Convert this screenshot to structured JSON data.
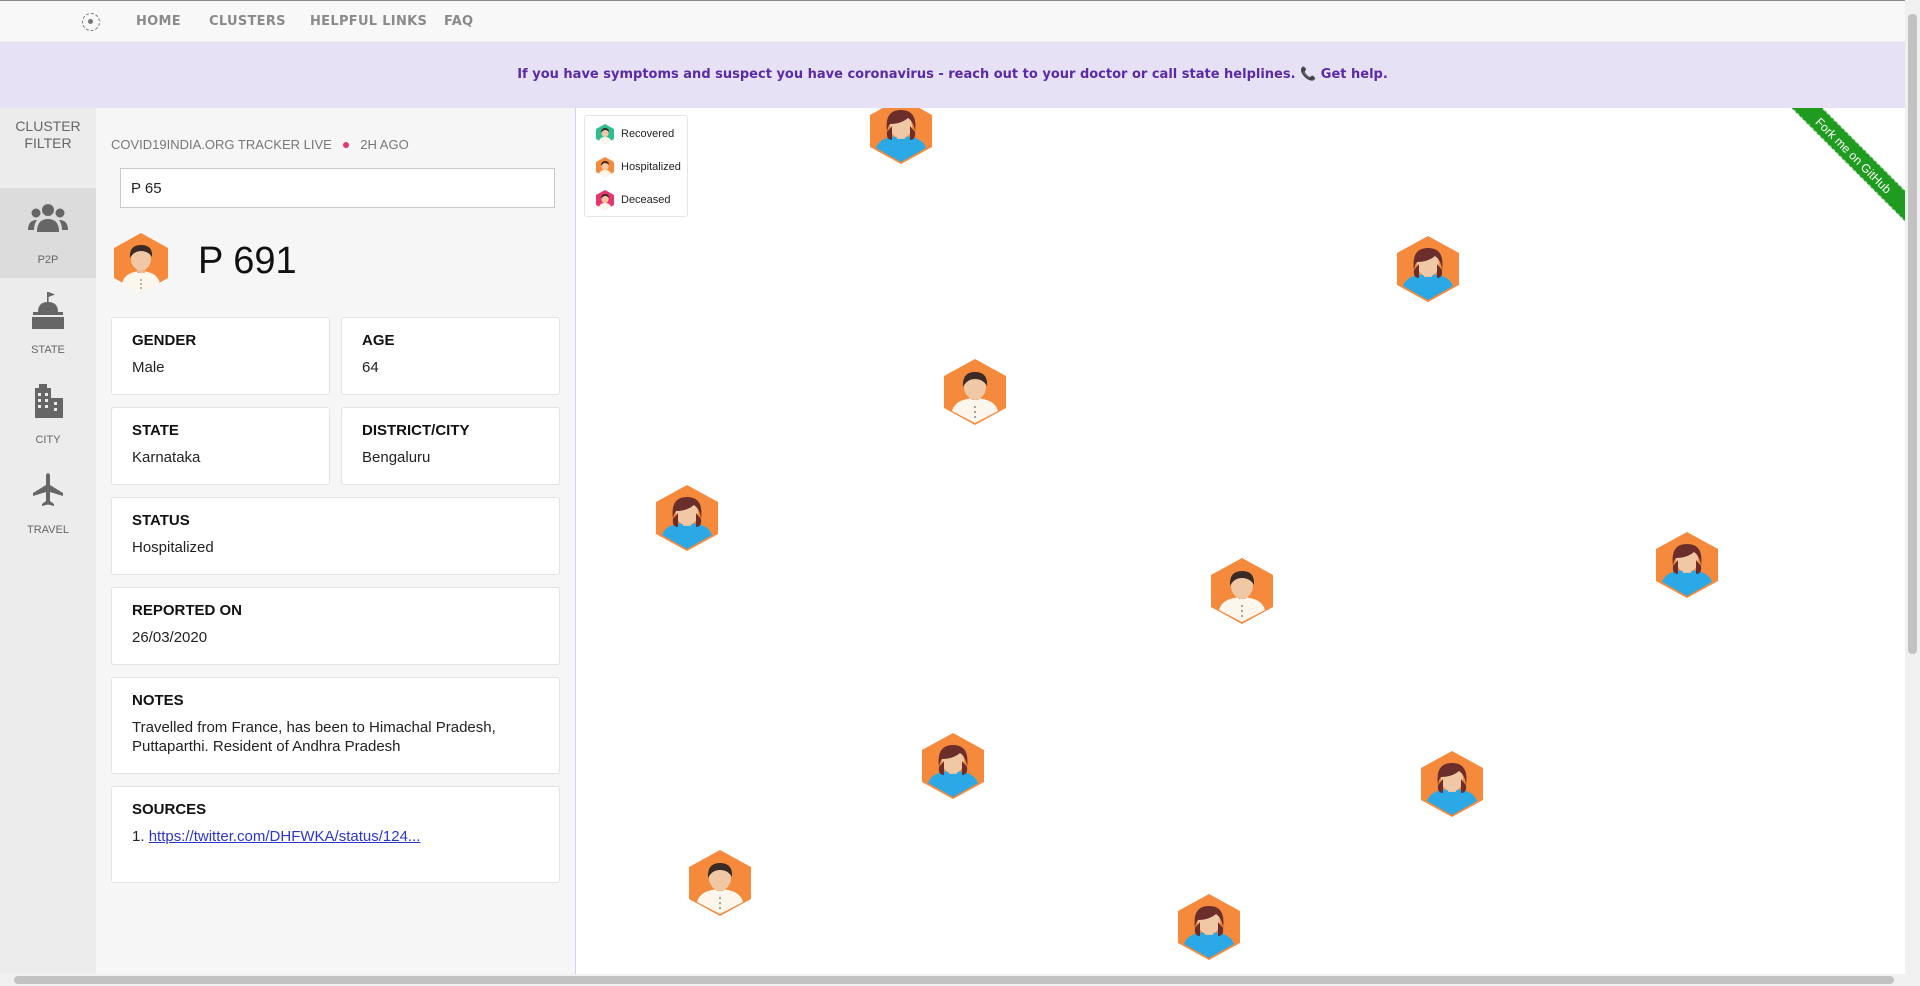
{
  "nav": {
    "home": "HOME",
    "clusters": "CLUSTERS",
    "helpful_links": "HELPFUL LINKS",
    "faq": "FAQ"
  },
  "banner": {
    "text": "If you have symptoms and suspect you have coronavirus - reach out to your doctor or call state helplines. 📞 ",
    "link": "Get help."
  },
  "filter": {
    "title_line1": "CLUSTER",
    "title_line2": "FILTER",
    "items": [
      {
        "label": "P2P",
        "icon": "people-icon",
        "active": true
      },
      {
        "label": "STATE",
        "icon": "capitol-icon",
        "active": false
      },
      {
        "label": "CITY",
        "icon": "city-icon",
        "active": false
      },
      {
        "label": "TRAVEL",
        "icon": "airplane-icon",
        "active": false
      }
    ]
  },
  "tracker": {
    "label": "COVID19INDIA.ORG TRACKER LIVE",
    "updated": "2H AGO"
  },
  "search": {
    "value": "P 65"
  },
  "patient": {
    "id": "P 691",
    "gender_label": "GENDER",
    "gender": "Male",
    "age_label": "AGE",
    "age": "64",
    "state_label": "STATE",
    "state": "Karnataka",
    "district_label": "DISTRICT/CITY",
    "district": "Bengaluru",
    "status_label": "STATUS",
    "status": "Hospitalized",
    "reported_label": "REPORTED ON",
    "reported": "26/03/2020",
    "notes_label": "NOTES",
    "notes": "Travelled from France, has been to Himachal Pradesh, Puttaparthi. Resident of Andhra Pradesh",
    "sources_label": "SOURCES",
    "source_index": "1.",
    "source_link": "https://twitter.com/DHFWKA/status/124..."
  },
  "legend": {
    "recovered": "Recovered",
    "hospitalized": "Hospitalized",
    "deceased": "Deceased"
  },
  "ribbon": {
    "text": "Fork me on GitHub"
  },
  "colors": {
    "recovered": "#2dbf8e",
    "hospitalized": "#f58a3c",
    "deceased": "#e7366b",
    "banner_text": "#5b2aa6",
    "ribbon": "#1f9b1f"
  }
}
